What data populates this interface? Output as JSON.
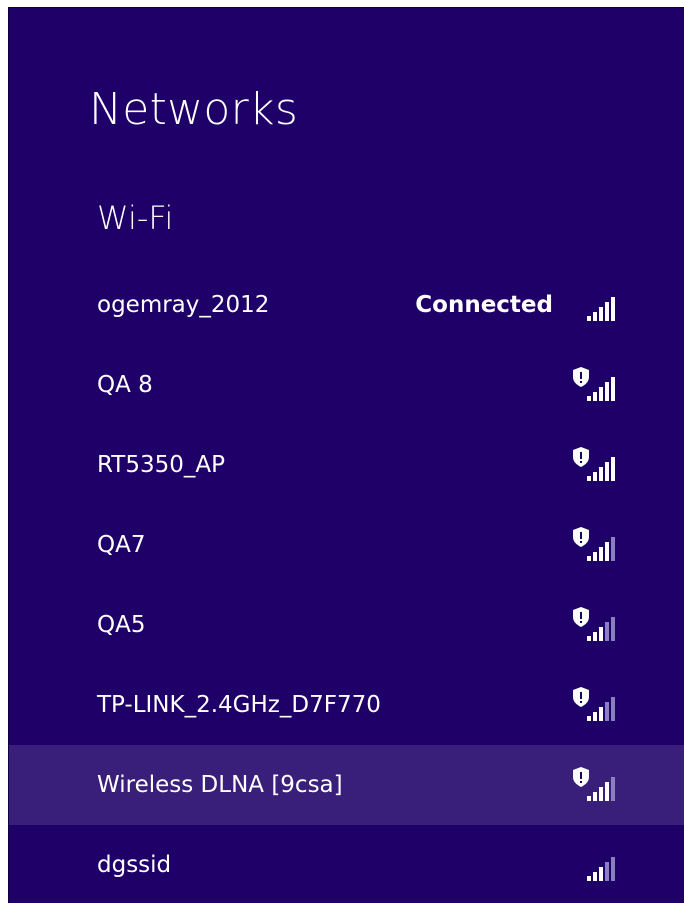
{
  "panel": {
    "title": "Networks",
    "section_title": "Wi-Fi"
  },
  "networks": [
    {
      "ssid": "ogemray_2012",
      "status": "Connected",
      "secured": false,
      "signal_bars": 5,
      "selected": false,
      "icon": "wifi-signal-icon"
    },
    {
      "ssid": "QA 8",
      "status": "",
      "secured": true,
      "signal_bars": 5,
      "selected": false,
      "icon": "wifi-signal-shield-icon"
    },
    {
      "ssid": "RT5350_AP",
      "status": "",
      "secured": true,
      "signal_bars": 5,
      "selected": false,
      "icon": "wifi-signal-shield-icon"
    },
    {
      "ssid": "QA7",
      "status": "",
      "secured": true,
      "signal_bars": 4,
      "selected": false,
      "icon": "wifi-signal-shield-icon"
    },
    {
      "ssid": "QA5",
      "status": "",
      "secured": true,
      "signal_bars": 3,
      "selected": false,
      "icon": "wifi-signal-shield-icon"
    },
    {
      "ssid": "TP-LINK_2.4GHz_D7F770",
      "status": "",
      "secured": true,
      "signal_bars": 3,
      "selected": false,
      "icon": "wifi-signal-shield-icon"
    },
    {
      "ssid": "Wireless DLNA [9csa]",
      "status": "",
      "secured": true,
      "signal_bars": 4,
      "selected": true,
      "icon": "wifi-signal-shield-icon"
    },
    {
      "ssid": "dgssid",
      "status": "",
      "secured": false,
      "signal_bars": 3,
      "selected": false,
      "icon": "wifi-signal-icon"
    }
  ],
  "colors": {
    "panel_background": "#1f0068",
    "selected_row": "#3a1f7a",
    "text": "#ffffff",
    "signal_active": "#ffffff",
    "signal_inactive": "#8a7fc0"
  }
}
